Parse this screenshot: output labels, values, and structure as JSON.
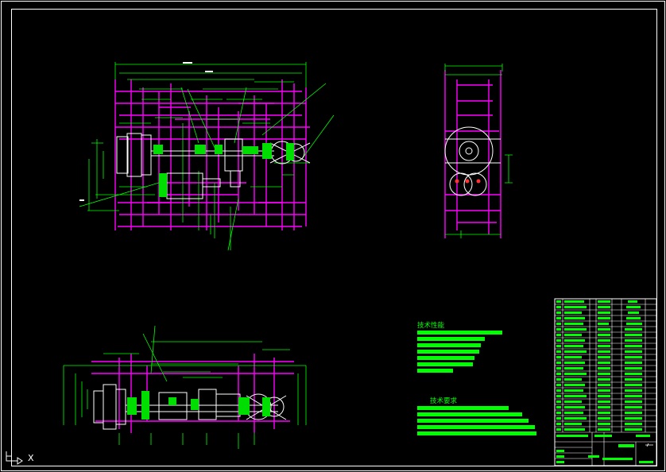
{
  "drawing": {
    "colors": {
      "background": "#000000",
      "frame": "#ffffff",
      "geometry": "#ffffff",
      "hidden_lines": "#ff00ff",
      "dimensions": "#00ff00",
      "leaders": "#00ff00",
      "text_blocks": "#00ff00",
      "title_block": "#ffffff"
    },
    "views": [
      {
        "name": "front-view"
      },
      {
        "name": "side-view"
      },
      {
        "name": "plan-view"
      }
    ]
  },
  "notes": {
    "performance_heading": "技术性能",
    "requirements_heading": "技术要求"
  },
  "ucs": {
    "axis_label": "X"
  }
}
